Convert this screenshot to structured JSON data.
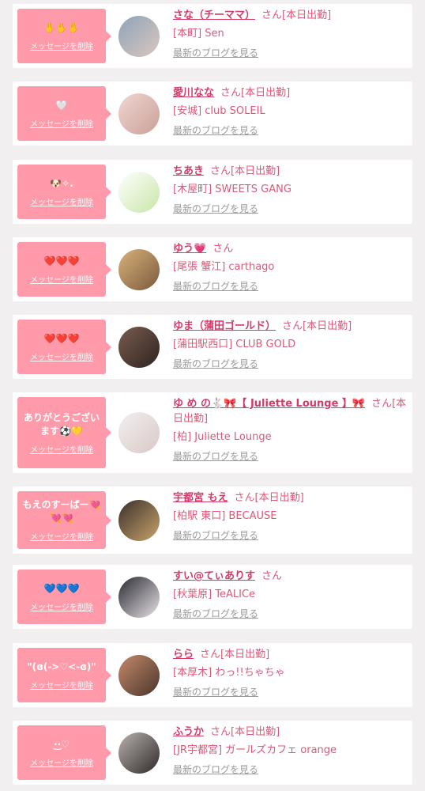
{
  "messages": [
    {
      "bubble_text": "✋✋✋",
      "delete_label": "メッセージを削除",
      "name": "さな（チーママ）",
      "suffix": "さん[本日出勤]",
      "shop": "[本町] Sen",
      "blog": "最新のブログを見る",
      "avatar_colors": [
        "#8fa3b8",
        "#d9c7bf"
      ]
    },
    {
      "bubble_text": "🤍",
      "delete_label": "メッセージを削除",
      "name": "愛川なな",
      "suffix": "さん[本日出勤]",
      "shop": "[安城] club SOLEIL",
      "blog": "最新のブログを見る",
      "avatar_colors": [
        "#f0d6d3",
        "#caa097"
      ]
    },
    {
      "bubble_text": "🐶✧.",
      "delete_label": "メッセージを削除",
      "name": "ちあき",
      "suffix": "さん[本日出勤]",
      "shop": "[木屋町] SWEETS GANG",
      "blog": "最新のブログを見る",
      "avatar_colors": [
        "#ffffff",
        "#c8e6a8"
      ]
    },
    {
      "bubble_text": "❤️❤️❤️",
      "delete_label": "メッセージを削除",
      "name": "ゆう💗",
      "suffix": "さん",
      "shop": "[尾張 蟹江] carthago",
      "blog": "最新のブログを見る",
      "avatar_colors": [
        "#d8b27a",
        "#7c5a3d"
      ]
    },
    {
      "bubble_text": "❤️❤️❤️",
      "delete_label": "メッセージを削除",
      "name": "ゆま（蒲田ゴールド）",
      "suffix": "さん[本日出勤]",
      "shop": "[蒲田駅西口] CLUB GOLD",
      "blog": "最新のブログを見る",
      "avatar_colors": [
        "#7a5c4e",
        "#2e2320"
      ]
    },
    {
      "bubble_text": "ありがとうございます⚽️💛",
      "delete_label": "メッセージを削除",
      "name": "ゆ め の🐇🎀【 Juliette Lounge 】🎀",
      "suffix": "さん[本日出勤]",
      "shop": "[柏] Juliette Lounge",
      "blog": "最新のブログを見る",
      "avatar_colors": [
        "#f2efef",
        "#d9c9c7"
      ]
    },
    {
      "bubble_text": "もえのすーぱー💘💘💘",
      "delete_label": "メッセージを削除",
      "name": "宇都宮 もえ",
      "suffix": "さん[本日出勤]",
      "shop": "[柏駅 東口] BECAUSE",
      "blog": "最新のブログを見る",
      "avatar_colors": [
        "#3a2f2d",
        "#c9a46a"
      ]
    },
    {
      "bubble_text": "💙💙💙",
      "delete_label": "メッセージを削除",
      "name": "すい@てぃありす",
      "suffix": "さん",
      "shop": "[秋葉原] TeALICe",
      "blog": "最新のブログを見る",
      "avatar_colors": [
        "#2a2a33",
        "#e8e2e6"
      ]
    },
    {
      "bubble_text": "\"(ɞ(->♡<-ɞ)\"",
      "delete_label": "メッセージを削除",
      "name": "らら",
      "suffix": "さん[本日出勤]",
      "shop": "[本厚木] わっ!!ちゃちゃ",
      "blog": "最新のブログを見る",
      "avatar_colors": [
        "#c48a6a",
        "#4b342c"
      ]
    },
    {
      "bubble_text": "·͜·♡",
      "delete_label": "メッセージを削除",
      "name": "ふうか",
      "suffix": "さん[本日出勤]",
      "shop": "[JR宇都宮] ガールズカフェ orange",
      "blog": "最新のブログを見る",
      "avatar_colors": [
        "#b9b1ad",
        "#2f2a2a"
      ]
    }
  ]
}
